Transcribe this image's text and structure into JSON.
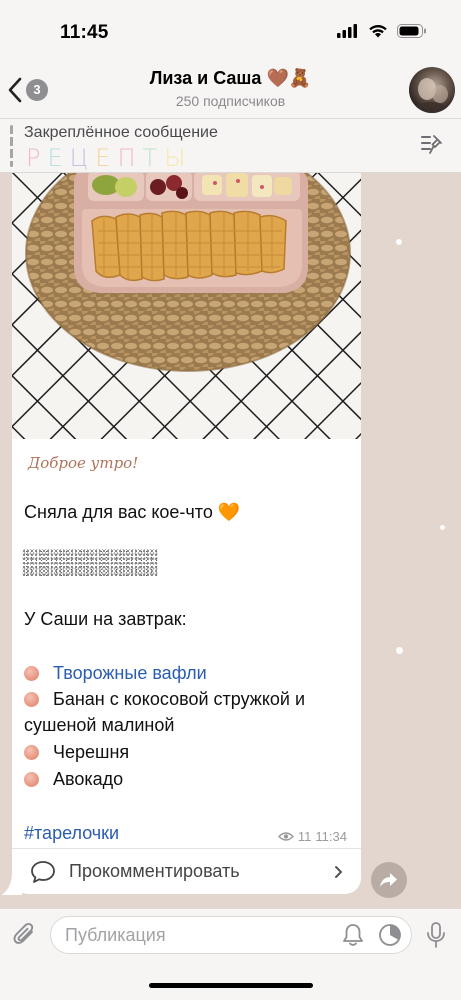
{
  "status_bar": {
    "time": "11:45"
  },
  "header": {
    "back_badge": "3",
    "title": "Лиза и Саша 🤎🧸",
    "subtitle": "250 подписчиков"
  },
  "pinned": {
    "title": "Закреплённое сообщение",
    "letters": [
      {
        "char": "Р",
        "color": "#f1b9c4"
      },
      {
        "char": "Е",
        "color": "#b8dfe0"
      },
      {
        "char": "Ц",
        "color": "#c9c0e6"
      },
      {
        "char": "Е",
        "color": "#f4d6a4"
      },
      {
        "char": "П",
        "color": "#f1b9c4"
      },
      {
        "char": "Т",
        "color": "#bfe3c8"
      },
      {
        "char": "Ы",
        "color": "#f7e7a9"
      }
    ]
  },
  "message": {
    "italic_caption": "Доброе утро!",
    "line1": "Сняла для вас кое-что 🧡",
    "heading": "У Саши на завтрак:",
    "items": [
      {
        "text": "Творожные вафли",
        "is_link": true
      },
      {
        "text": "Банан с кокосовой стружкой и",
        "continuation": "сушеной малиной",
        "is_link": false
      },
      {
        "text": "Черешня",
        "is_link": false
      },
      {
        "text": "Авокадо",
        "is_link": false
      }
    ],
    "hashtag": "#тарелочки",
    "views": "11",
    "time": "11:34",
    "comment_label": "Прокомментировать"
  },
  "input": {
    "placeholder": "Публикация"
  },
  "colors": {
    "chat_background": "#e3d6cf",
    "link": "#2a5db0",
    "bars": "#f7f5f3"
  }
}
